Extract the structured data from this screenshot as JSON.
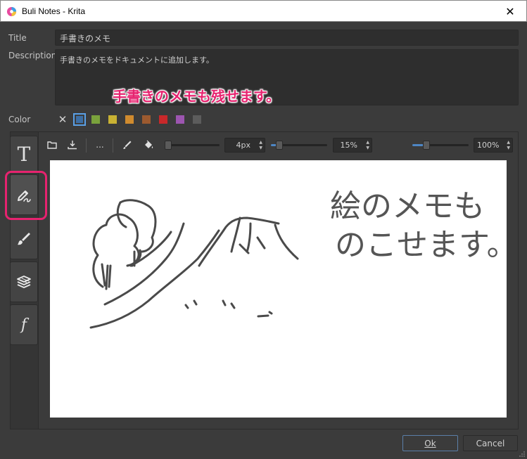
{
  "window": {
    "title": "Buli Notes - Krita",
    "close_glyph": "✕"
  },
  "form": {
    "title_label": "Title",
    "title_value": "手書きのメモ",
    "description_label": "Description",
    "description_value": "手書きのメモをドキュメントに追加します。",
    "color_label": "Color",
    "annotation": "手書きのメモも残せます。"
  },
  "colors": {
    "no_color_glyph": "✕",
    "swatches": [
      "#3d6fa5",
      "#7aa23c",
      "#c9b233",
      "#d08b2e",
      "#9c5a2f",
      "#c8282a",
      "#9c55b0",
      "#5c5c5c"
    ],
    "selected": "#3d6fa5"
  },
  "side_tabs": {
    "text_tab_glyph": "T",
    "script_tab_glyph": "f",
    "icons": [
      "text-icon",
      "vector-pen-icon",
      "brush-icon",
      "layers-icon",
      "function-icon"
    ]
  },
  "toolbar": {
    "more_label": "...",
    "size_value": "4px",
    "size_fraction": 0.05,
    "opacity_value": "15%",
    "opacity_fraction": 0.15,
    "zoom_value": "100%",
    "zoom_fraction": 0.25
  },
  "canvas": {
    "handwriting_line1": "絵のメモも",
    "handwriting_line2": "のこせます。"
  },
  "buttons": {
    "ok_label": "Ok",
    "cancel_label": "Cancel"
  },
  "accent": {
    "highlight": "#e6236f",
    "focus": "#5b7fa8"
  }
}
